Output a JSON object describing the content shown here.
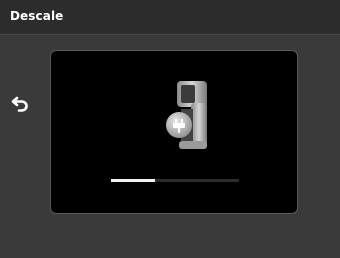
{
  "header": {
    "title": "Descale"
  },
  "controls": {
    "back_icon": "back-arrow-icon"
  },
  "main": {
    "illustration_icon": "coffee-machine-descale-icon",
    "progress": 0.34
  },
  "colors": {
    "background": "#3a3a3a",
    "header_bg": "#2c2c2c",
    "panel_bg": "#000000",
    "progress_fill": "#f2f2f2",
    "progress_track": "#2b2b2b"
  }
}
